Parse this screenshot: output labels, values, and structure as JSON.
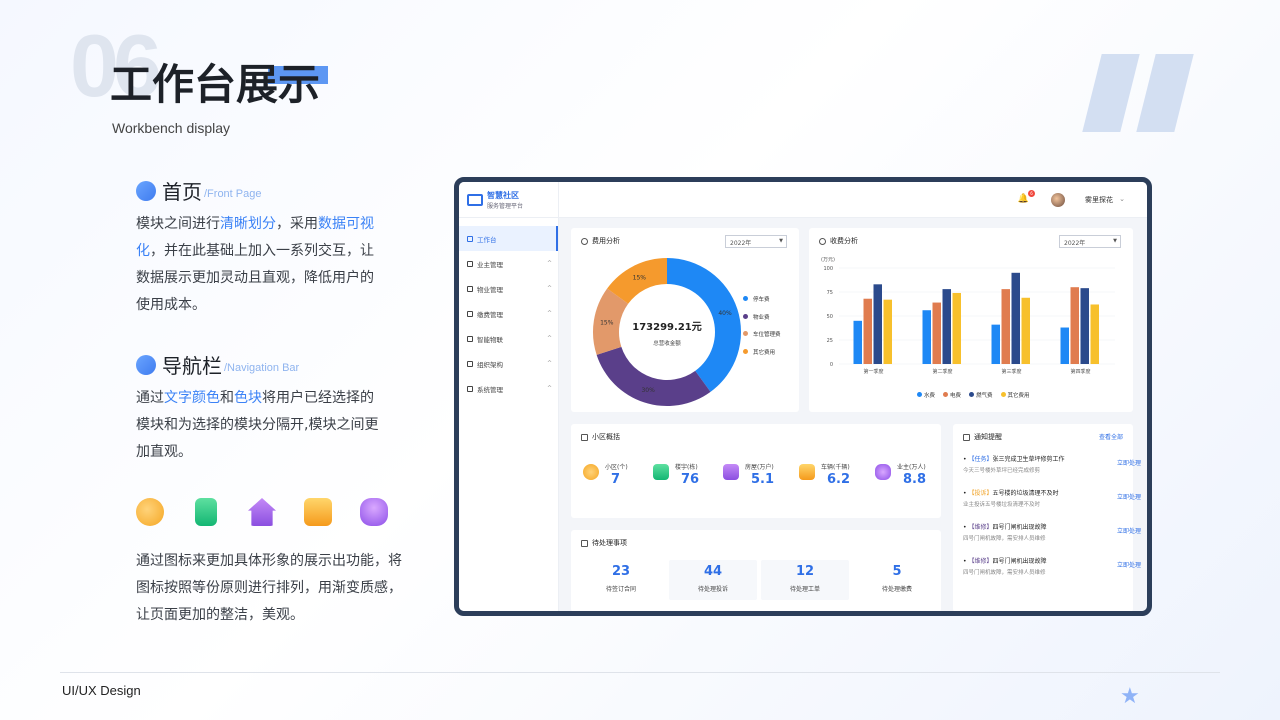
{
  "header": {
    "number": "06",
    "title": "工作台展示",
    "subtitle": "Workbench display"
  },
  "sections": [
    {
      "title": "首页",
      "en": "/Front Page",
      "text_parts": [
        "模块之间进行",
        "清晰划分",
        "，采用",
        "数据可视化",
        "，并在此基础上加入一系列交互，让数据展示更加灵动且直观，降低用户的使用成本。"
      ]
    },
    {
      "title": "导航栏",
      "en": "/Navigation Bar",
      "text_parts": [
        "通过",
        "文字颜色",
        "和",
        "色块",
        "将用户已经选择的模块和为选择的模块分隔开,模块之间更加直观。"
      ]
    }
  ],
  "icons_caption": "通过图标来更加具体形象的展示出功能，将图标按照等份原则进行排列，用渐变质感，让页面更加的整洁，美观。",
  "footer": "UI/UX Design",
  "dashboard": {
    "brand": {
      "name": "智慧社区",
      "sub": "服务管理平台"
    },
    "nav": [
      {
        "label": "工作台",
        "active": true
      },
      {
        "label": "业主管理"
      },
      {
        "label": "物业管理"
      },
      {
        "label": "缴费管理"
      },
      {
        "label": "智能物联"
      },
      {
        "label": "组织架构"
      },
      {
        "label": "系统管理"
      }
    ],
    "user": {
      "name": "雾里探花",
      "badge": "6"
    },
    "fee": {
      "title": "费用分析",
      "year": "2022年",
      "total": "173299.21元",
      "total_label": "总营收金额",
      "labels": [
        "40%",
        "30%",
        "15%",
        "15%"
      ]
    },
    "charge": {
      "title": "收费分析",
      "year": "2022年",
      "unit": "(万元)"
    },
    "community": {
      "title": "小区概括",
      "stats": [
        {
          "label": "小区(个)",
          "value": "7"
        },
        {
          "label": "楼宇(栋)",
          "value": "76"
        },
        {
          "label": "房屋(万户)",
          "value": "5.1"
        },
        {
          "label": "车辆(千辆)",
          "value": "6.2"
        },
        {
          "label": "业主(万人)",
          "value": "8.8"
        }
      ]
    },
    "todo": {
      "title": "待处理事项",
      "items": [
        {
          "value": "23",
          "label": "待签订合同"
        },
        {
          "value": "44",
          "label": "待处理投诉"
        },
        {
          "value": "12",
          "label": "待处理工单"
        },
        {
          "value": "5",
          "label": "待处理缴费"
        }
      ]
    },
    "notice": {
      "title": "通知提醒",
      "more": "查看全部",
      "action": "立即处理",
      "items": [
        {
          "tag": "【任务】",
          "text": "张三完成卫生草坪修剪工作",
          "sub": "今天三号楼外草坪已经完成修剪"
        },
        {
          "tag": "【投诉】",
          "text": "五号楼的垃圾清理不及时",
          "sub": "业主投诉五号楼垃圾清理不及时"
        },
        {
          "tag": "【维修】",
          "text": "四号门闸机出现故障",
          "sub": "四号门闸机故障，需安排人员维修"
        },
        {
          "tag": "【维修】",
          "text": "四号门闸机出现故障",
          "sub": "四号门闸机故障，需安排人员维修"
        }
      ]
    }
  },
  "chart_data": [
    {
      "type": "pie",
      "title": "费用分析",
      "categories": [
        "停车费",
        "物业费",
        "车位管理费",
        "其它费用"
      ],
      "values": [
        40,
        30,
        15,
        15
      ],
      "colors": [
        "#1e88f5",
        "#5a3f8a",
        "#e2996a",
        "#f59a2d"
      ]
    },
    {
      "type": "bar",
      "title": "收费分析",
      "ylabel": "(万元)",
      "categories": [
        "第一季度",
        "第二季度",
        "第三季度",
        "第四季度"
      ],
      "ylim": [
        0,
        100
      ],
      "yticks": [
        0,
        25,
        50,
        75,
        100
      ],
      "series": [
        {
          "name": "水费",
          "values": [
            45,
            56,
            41,
            38
          ],
          "color": "#1e88f5"
        },
        {
          "name": "电费",
          "values": [
            68,
            64,
            78,
            80
          ],
          "color": "#e07c4f"
        },
        {
          "name": "燃气费",
          "values": [
            83,
            78,
            95,
            79
          ],
          "color": "#2b4a8c"
        },
        {
          "name": "其它费用",
          "values": [
            67,
            74,
            69,
            62
          ],
          "color": "#f7c02c"
        }
      ]
    }
  ]
}
